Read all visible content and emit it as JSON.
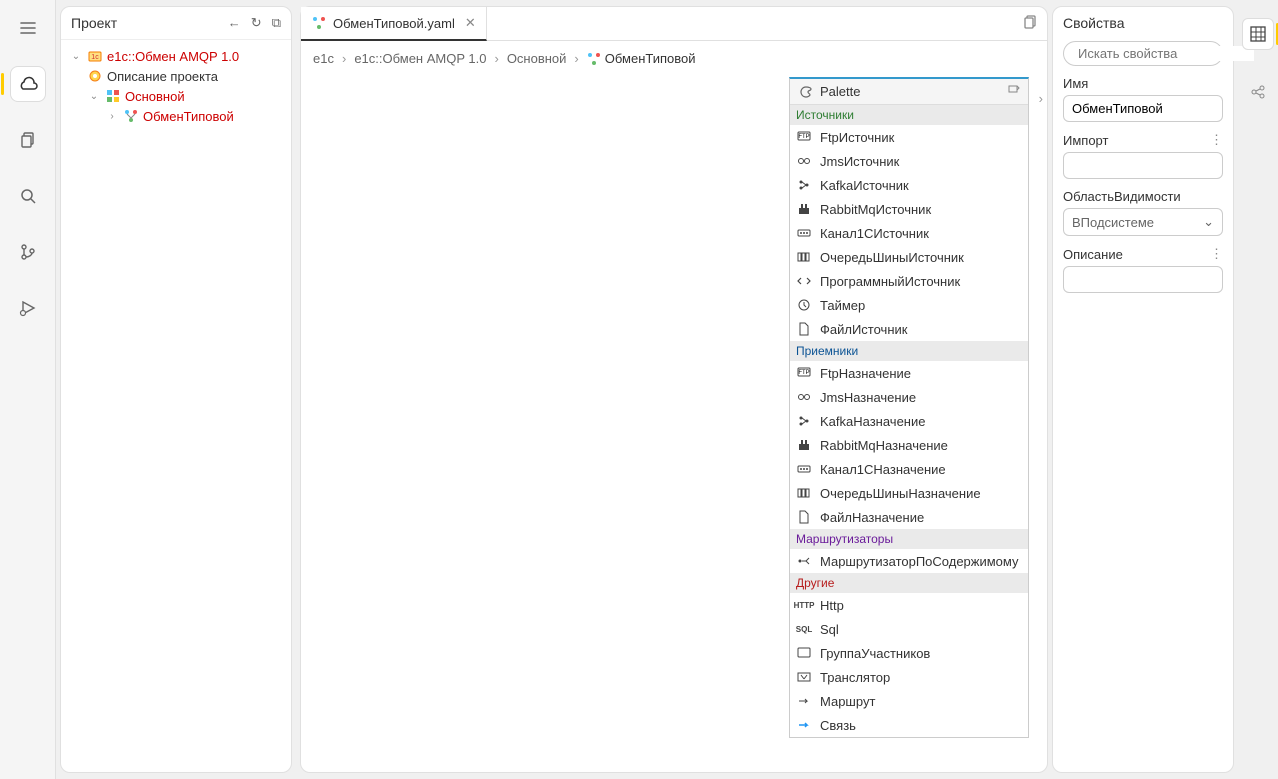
{
  "project": {
    "title": "Проект",
    "tree": {
      "root": "e1c::Обмен AMQP 1.0",
      "desc": "Описание проекта",
      "main": "Основной",
      "exchange": "ОбменТиповой"
    }
  },
  "tab": {
    "label": "ОбменТиповой.yaml"
  },
  "breadcrumb": {
    "items": [
      "e1c",
      "e1c::Обмен AMQP 1.0",
      "Основной",
      "ОбменТиповой"
    ]
  },
  "palette": {
    "title": "Palette",
    "sections": {
      "sources": "Источники",
      "sinks": "Приемники",
      "routers": "Маршрутизаторы",
      "other": "Другие"
    },
    "items": {
      "ftp_src": "FtpИсточник",
      "jms_src": "JmsИсточник",
      "kafka_src": "KafkaИсточник",
      "rabbit_src": "RabbitMqИсточник",
      "chan1c_src": "Канал1СИсточник",
      "queue_src": "ОчередьШиныИсточник",
      "prog_src": "ПрограммныйИсточник",
      "timer": "Таймер",
      "file_src": "ФайлИсточник",
      "ftp_dst": "FtpНазначение",
      "jms_dst": "JmsНазначение",
      "kafka_dst": "KafkaНазначение",
      "rabbit_dst": "RabbitMqНазначение",
      "chan1c_dst": "Канал1СНазначение",
      "queue_dst": "ОчередьШиныНазначение",
      "file_dst": "ФайлНазначение",
      "content_router": "МаршрутизаторПоСодержимому",
      "http": "Http",
      "sql": "Sql",
      "group": "ГруппаУчастников",
      "translator": "Транслятор",
      "route": "Маршрут",
      "link": "Связь"
    }
  },
  "props": {
    "title": "Свойства",
    "search_placeholder": "Искать свойства",
    "name_label": "Имя",
    "name_value": "ОбменТиповой",
    "import_label": "Импорт",
    "visibility_label": "ОбластьВидимости",
    "visibility_value": "ВПодсистеме",
    "desc_label": "Описание"
  }
}
